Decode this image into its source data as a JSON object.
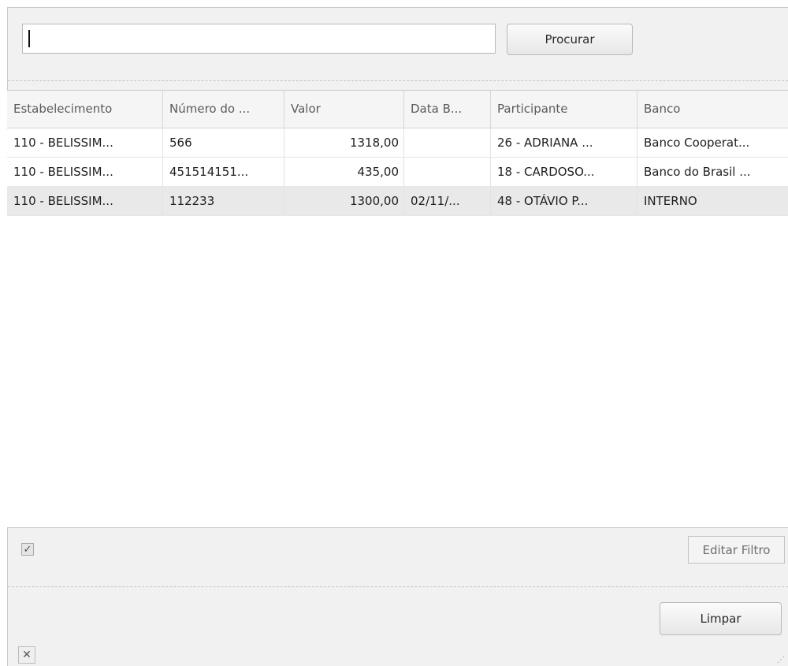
{
  "search": {
    "value": "",
    "button_label": "Procurar"
  },
  "grid": {
    "columns": [
      "Estabelecimento",
      "Número do ...",
      "Valor",
      "Data B...",
      "Participante",
      "Banco"
    ],
    "rows": [
      [
        "110 - BELISSIM...",
        "566",
        "1318,00",
        "",
        "26 - ADRIANA ...",
        "Banco Cooperat..."
      ],
      [
        "110 - BELISSIM...",
        "451514151...",
        "435,00",
        "",
        "18 - CARDOSO...",
        "Banco do Brasil ..."
      ],
      [
        "110 - BELISSIM...",
        "112233",
        "1300,00",
        "02/11/...",
        "48 - OTÁVIO P...",
        "INTERNO"
      ]
    ],
    "selected_row": 2
  },
  "filter": {
    "checkbox_checked": true,
    "checkbox_glyph": "✓",
    "edit_label": "Editar Filtro"
  },
  "footer": {
    "clear_label": "Limpar",
    "close_glyph": "✕",
    "grip_glyph": "⋰"
  },
  "colors": {
    "panel_bg": "#f1f1f1",
    "grid_bg": "#ffffff",
    "selected_row_bg": "#e9e9e9",
    "border": "#c9c9c9"
  }
}
